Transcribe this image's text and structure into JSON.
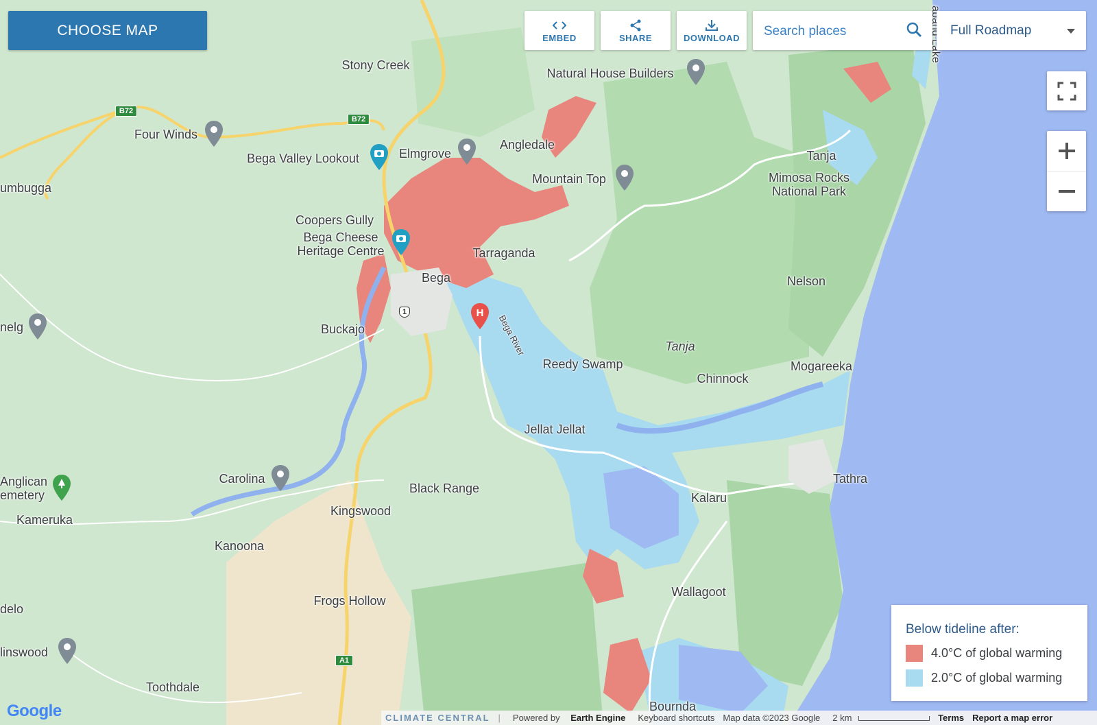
{
  "toolbar": {
    "choose_map_label": "CHOOSE MAP",
    "embed_label": "EMBED",
    "share_label": "SHARE",
    "download_label": "DOWNLOAD",
    "search_placeholder": "Search places",
    "map_type_value": "Full Roadmap"
  },
  "legend": {
    "title": "Below tideline after:",
    "items": [
      {
        "label": "4.0°C of global warming",
        "color": "#e8857c"
      },
      {
        "label": "2.0°C of global warming",
        "color": "#a8daf0"
      }
    ]
  },
  "places": {
    "stony_creek": "Stony Creek",
    "natural_house_builders": "Natural House Builders",
    "four_winds": "Four Winds",
    "bega_valley_lookout": "Bega Valley Lookout",
    "elmgrove": "Elmgrove",
    "angledale": "Angledale",
    "mountain_top": "Mountain Top",
    "tanja_town": "Tanja",
    "mimosa_rocks": "Mimosa Rocks\nNational Park",
    "umbugga": "umbugga",
    "coopers_gully": "Coopers Gully",
    "bega_cheese": "Bega Cheese\nHeritage Centre",
    "tarraganda": "Tarraganda",
    "bega": "Bega",
    "nelson": "Nelson",
    "nelg": "nelg",
    "buckajo": "Buckajo",
    "bega_river": "Bega River",
    "tanja_region": "Tanja",
    "reedy_swamp": "Reedy Swamp",
    "chinnock": "Chinnock",
    "mogareeka": "Mogareeka",
    "jellat_jellat": "Jellat Jellat",
    "carolina": "Carolina",
    "anglican_cemetery": "Anglican\nemetery",
    "black_range": "Black Range",
    "tathra": "Tathra",
    "kalaru": "Kalaru",
    "kingswood": "Kingswood",
    "kameruka": "Kameruka",
    "kanoona": "Kanoona",
    "wallagoot": "Wallagoot",
    "frogs_hollow": "Frogs Hollow",
    "delo": "delo",
    "linswood": "linswood",
    "toothdale": "Toothdale",
    "bournda": "Bournda",
    "lake_label": "apang Lake"
  },
  "road_shields": {
    "b72_west": "B72",
    "b72_east": "B72",
    "route_1": "1",
    "a1": "A1"
  },
  "footer": {
    "brand": "CLIMATE CENTRAL",
    "powered_by": "Powered by",
    "earth_engine": "Earth Engine",
    "keyboard": "Keyboard shortcuts",
    "map_data": "Map data ©2023 Google",
    "scale": "2 km",
    "terms": "Terms",
    "report": "Report a map error"
  },
  "google_logo": "Google",
  "colors": {
    "ocean": "#9fb9f2",
    "land": "#cfe6cf",
    "forest": "#a9d5a7",
    "flood_4c": "#e8857c",
    "flood_2c": "#a8daf0",
    "accent": "#2d77b0"
  }
}
